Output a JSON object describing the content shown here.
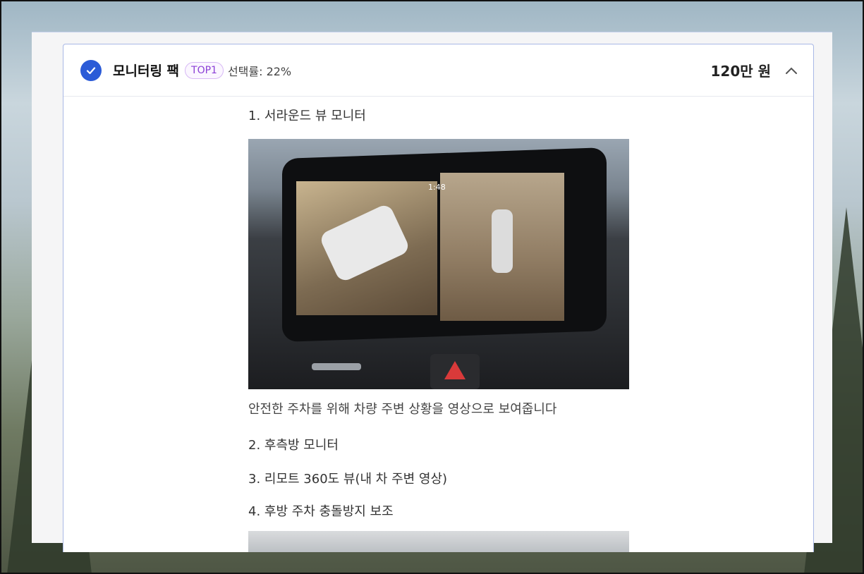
{
  "option": {
    "title": "모니터링 팩",
    "badge": "TOP1",
    "selection_rate": "선택률: 22%",
    "price": "120만 원",
    "selected": true,
    "expanded": true
  },
  "features": [
    {
      "label": "1. 서라운드 뷰 모니터"
    },
    {
      "label": "2. 후측방 모니터"
    },
    {
      "label": "3. 리모트 360도 뷰(내 차 주변 영상)"
    },
    {
      "label": "4. 후방 주차 충돌방지 보조"
    }
  ],
  "feature_1_description": "안전한 주차를 위해 차량 주변 상황을 영상으로 보여줍니다",
  "image_1_screen_time": "1:48",
  "colors": {
    "accent": "#2b5bd7",
    "badge_text": "#8b3fd6",
    "card_border": "#a9b8e6"
  },
  "icons": {
    "selected": "check-circle-icon",
    "collapse": "chevron-up-icon"
  }
}
